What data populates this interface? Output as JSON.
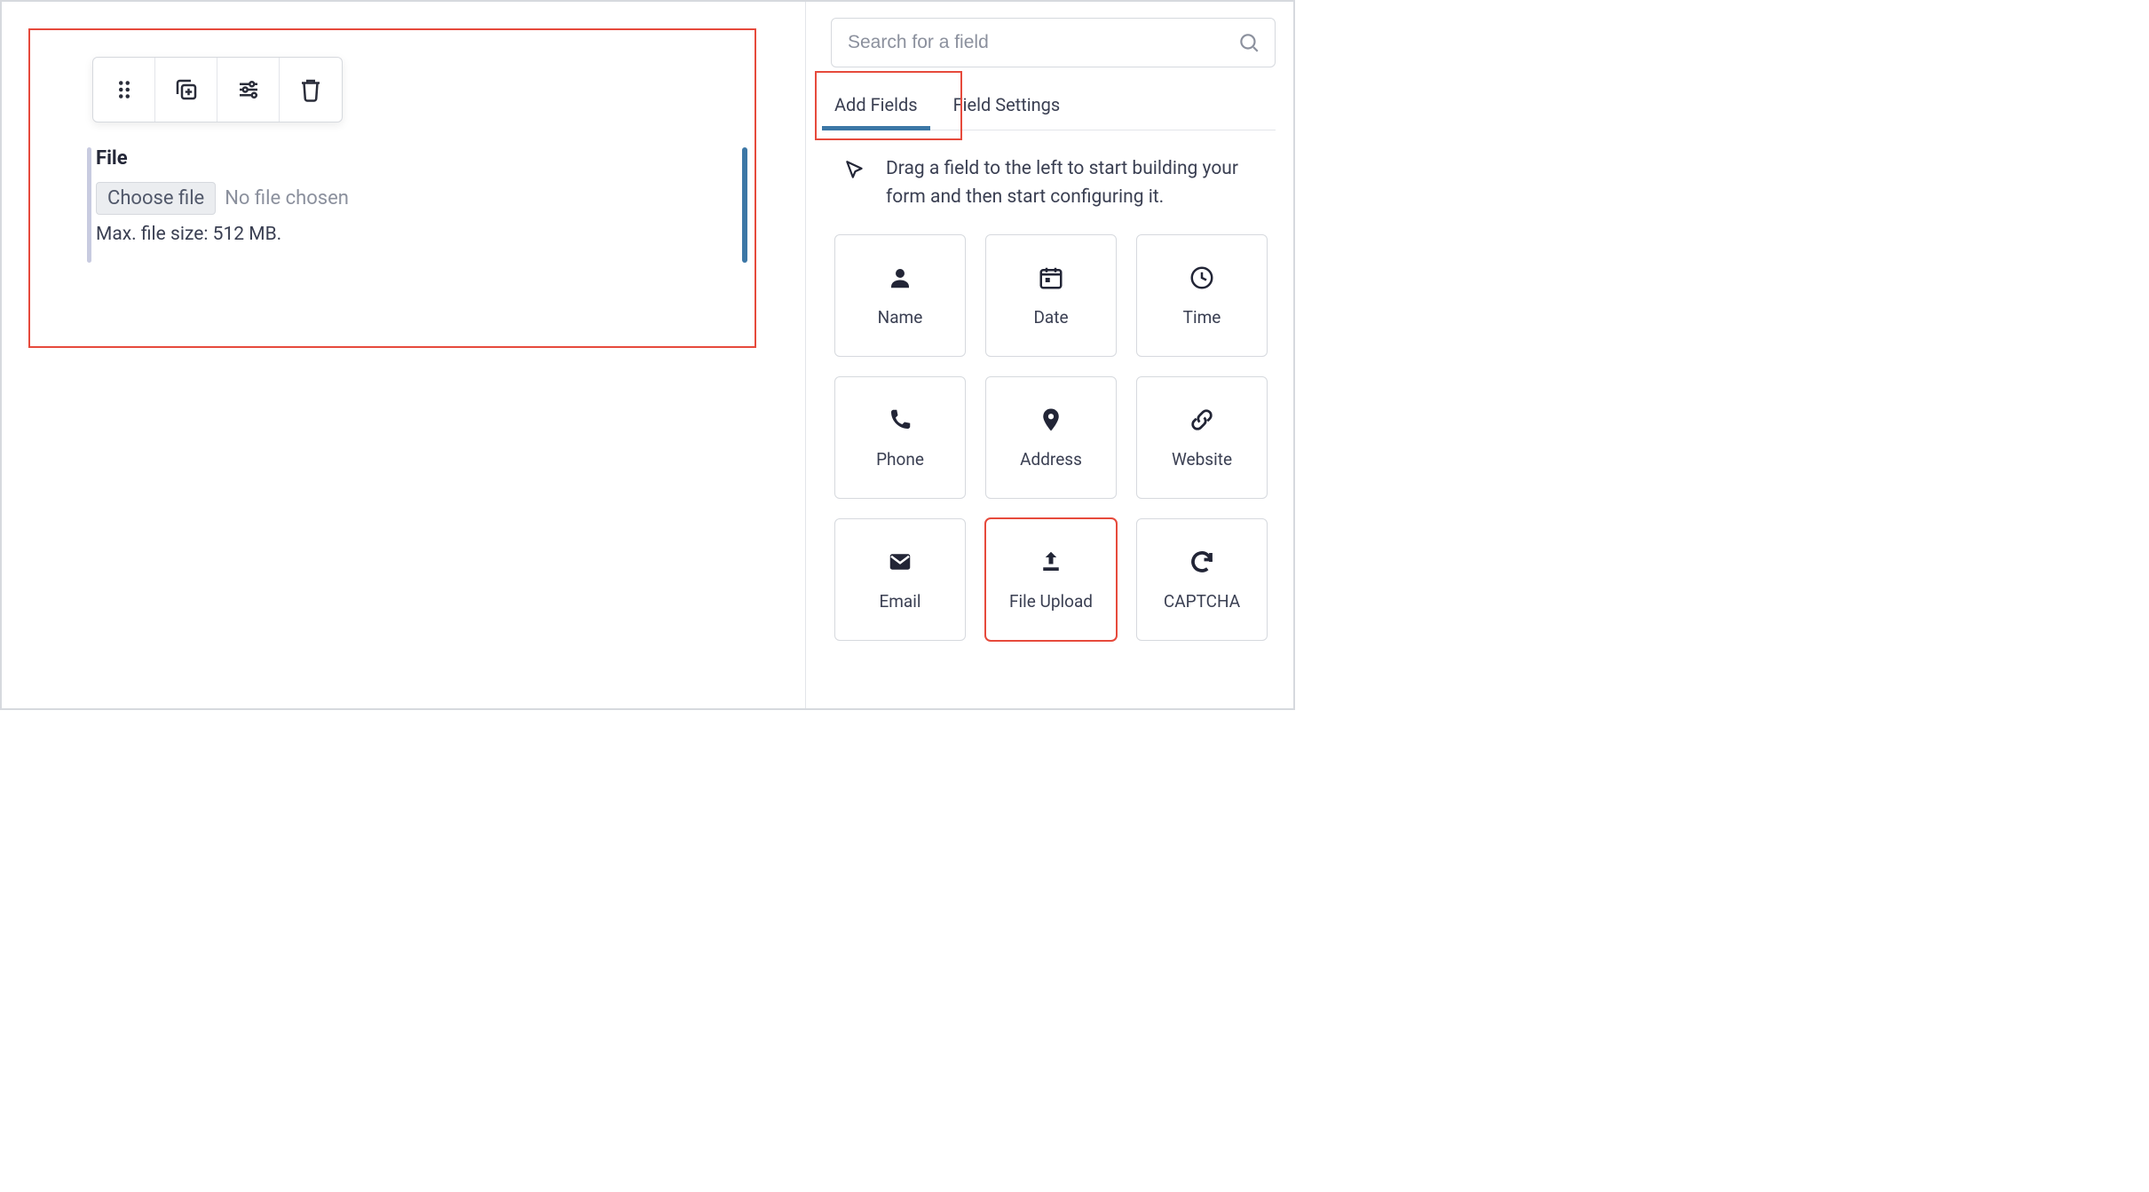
{
  "canvas": {
    "toolbar": {
      "items": [
        "drag",
        "duplicate",
        "settings",
        "delete"
      ]
    },
    "field": {
      "label": "File",
      "choose_label": "Choose file",
      "no_file_text": "No file chosen",
      "hint": "Max. file size: 512 MB."
    }
  },
  "sidepanel": {
    "search_placeholder": "Search for a field",
    "tabs": {
      "add_fields": "Add Fields",
      "field_settings": "Field Settings"
    },
    "drag_hint": "Drag a field to the left to start building your form and then start configuring it.",
    "fields": [
      {
        "icon": "name",
        "label": "Name"
      },
      {
        "icon": "date",
        "label": "Date"
      },
      {
        "icon": "time",
        "label": "Time"
      },
      {
        "icon": "phone",
        "label": "Phone"
      },
      {
        "icon": "address",
        "label": "Address"
      },
      {
        "icon": "website",
        "label": "Website"
      },
      {
        "icon": "email",
        "label": "Email"
      },
      {
        "icon": "fileupload",
        "label": "File Upload",
        "highlight": true
      },
      {
        "icon": "captcha",
        "label": "CAPTCHA"
      }
    ]
  }
}
